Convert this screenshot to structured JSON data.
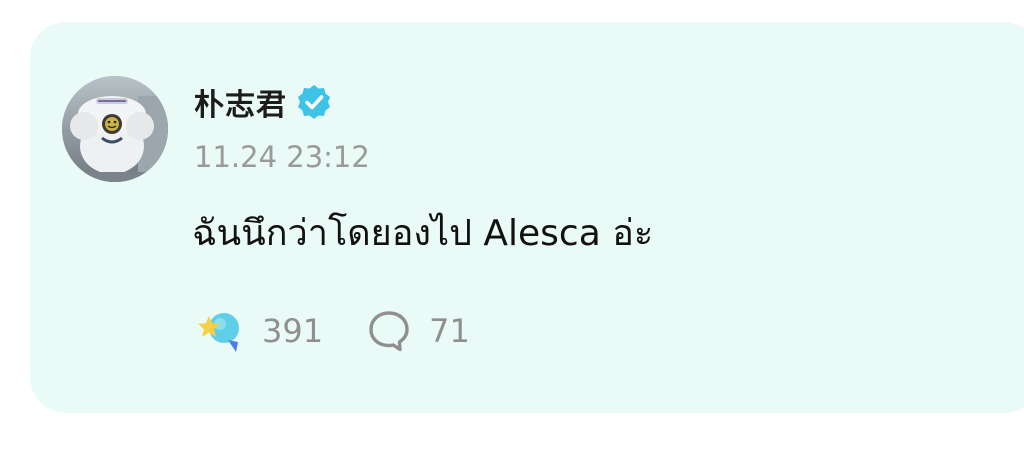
{
  "post": {
    "author_name": "朴志君",
    "verified": true,
    "timestamp": "11.24 23:12",
    "text": "ฉันนึกว่าโดยองไป Alesca อ่ะ",
    "likes_count": "391",
    "comments_count": "71"
  },
  "colors": {
    "card_bg": "#e9faf7",
    "verified_badge": "#3dc3e6",
    "muted_text": "#9a9a9a"
  },
  "icons": {
    "verified": "verified-badge-icon",
    "like": "star-bubble-icon",
    "comment": "speech-bubble-icon"
  }
}
